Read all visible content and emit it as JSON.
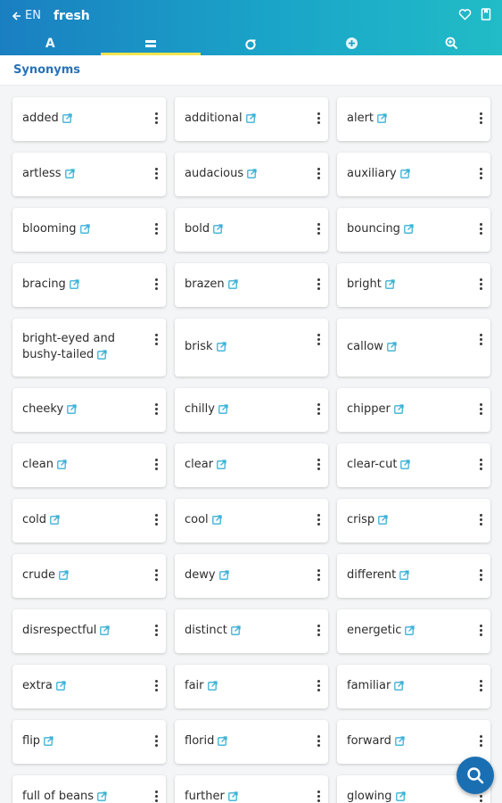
{
  "header": {
    "lang_label": "EN",
    "word": "fresh",
    "tabs": [
      {
        "name": "tab-definitions",
        "label": "A",
        "icon": "letter-a-icon",
        "active": false
      },
      {
        "name": "tab-synonyms",
        "icon": "equals-icon",
        "active": true
      },
      {
        "name": "tab-antonyms",
        "icon": "sigma-icon",
        "active": false
      },
      {
        "name": "tab-related",
        "icon": "plus-circle-icon",
        "active": false
      },
      {
        "name": "tab-search",
        "icon": "zoom-icon",
        "active": false
      }
    ],
    "actions": [
      "heart-icon",
      "bookmark-icon"
    ]
  },
  "section": {
    "title": "Synonyms"
  },
  "synonyms": [
    "added",
    "additional",
    "alert",
    "artless",
    "audacious",
    "auxiliary",
    "blooming",
    "bold",
    "bouncing",
    "bracing",
    "brazen",
    "bright",
    "bright-eyed and bushy-tailed",
    "brisk",
    "callow",
    "cheeky",
    "chilly",
    "chipper",
    "clean",
    "clear",
    "clear-cut",
    "cold",
    "cool",
    "crisp",
    "crude",
    "dewy",
    "different",
    "disrespectful",
    "distinct",
    "energetic",
    "extra",
    "fair",
    "familiar",
    "flip",
    "florid",
    "forward",
    "full of beans",
    "further",
    "glowing"
  ],
  "colors": {
    "accent": "#1a7fc1",
    "tab_indicator": "#f3e44e",
    "link_icon": "#3ab0d6",
    "section_title": "#2872b8"
  }
}
